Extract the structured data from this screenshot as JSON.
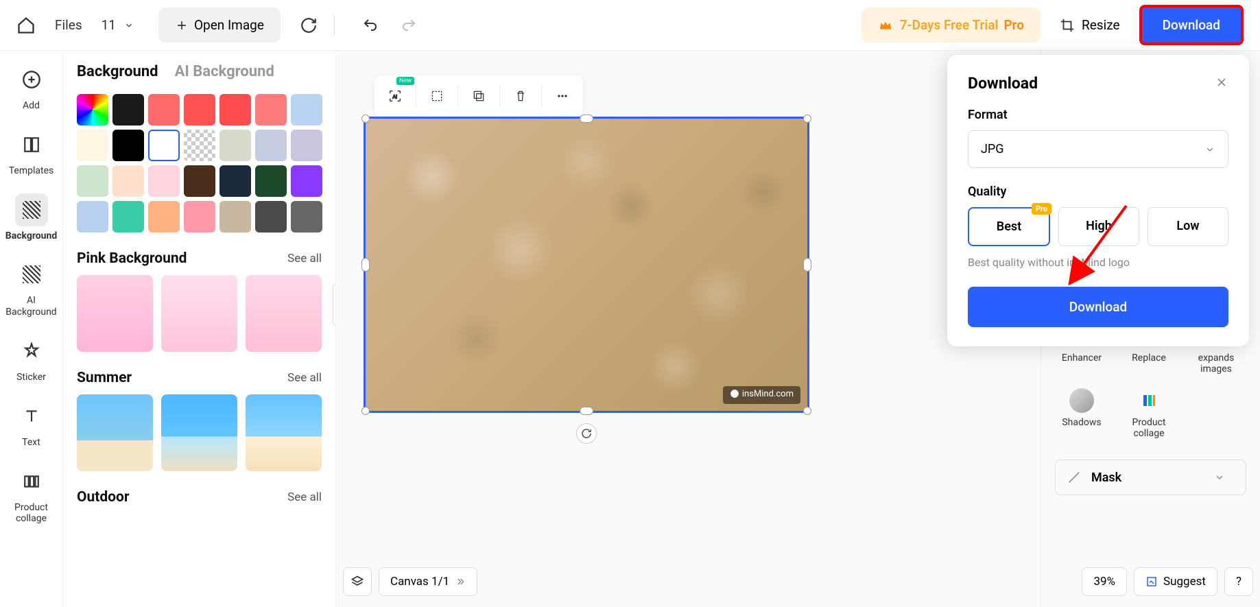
{
  "topbar": {
    "files_label": "Files",
    "files_count": "11",
    "open_image_label": "Open Image",
    "trial_label": "7-Days Free Trial",
    "trial_pro": "Pro",
    "resize_label": "Resize",
    "download_label": "Download"
  },
  "left_nav": {
    "items": [
      {
        "label": "Add"
      },
      {
        "label": "Templates"
      },
      {
        "label": "Background"
      },
      {
        "label": "AI\nBackground"
      },
      {
        "label": "Sticker"
      },
      {
        "label": "Text"
      },
      {
        "label": "Product\ncollage"
      }
    ]
  },
  "panel": {
    "tabs": {
      "background": "Background",
      "ai_background": "AI Background"
    },
    "swatches": [
      "rainbow",
      "#1a1a1a",
      "#ff6b6b",
      "#ff5252",
      "#ff4d4d",
      "#ff7b7b",
      "#b8d4f0",
      "#fdf6e3",
      "#000000",
      "#ffffff",
      "checker",
      "#d9d9cc",
      "#c5cce0",
      "#ccc5e0",
      "#cce5cc",
      "#ffe0cc",
      "#ffd6e0",
      "#4a2c1a",
      "#1a2a3a",
      "#1a4a2a",
      "#8a3aff",
      "#b8d0f0",
      "#3acca8",
      "#ffb380",
      "#ff99aa",
      "#c8b8a0",
      "#4a4a4a",
      "#666666"
    ],
    "sections": [
      {
        "title": "Pink Background",
        "see_all": "See all",
        "thumbs": [
          "pink1",
          "pink2",
          "pink3"
        ]
      },
      {
        "title": "Summer",
        "see_all": "See all",
        "thumbs": [
          "summer1",
          "summer2",
          "summer3"
        ]
      },
      {
        "title": "Outdoor",
        "see_all": "See all",
        "thumbs": []
      }
    ]
  },
  "canvas": {
    "watermark": "insMind.com"
  },
  "bottom_bar": {
    "canvas_label": "Canvas 1/1",
    "zoom": "39%",
    "suggest": "Suggest",
    "help": "?"
  },
  "right_panel": {
    "items": [
      {
        "label": "Enhancer"
      },
      {
        "label": "Replace"
      },
      {
        "label": "expands\nimages"
      },
      {
        "label": "Shadows"
      },
      {
        "label": "Product\ncollage"
      }
    ],
    "mask_label": "Mask"
  },
  "download_popup": {
    "title": "Download",
    "format_label": "Format",
    "format_value": "JPG",
    "quality_label": "Quality",
    "quality_options": [
      "Best",
      "High",
      "Low"
    ],
    "pro_badge": "Pro",
    "quality_hint": "Best quality without insMind logo",
    "action": "Download"
  }
}
